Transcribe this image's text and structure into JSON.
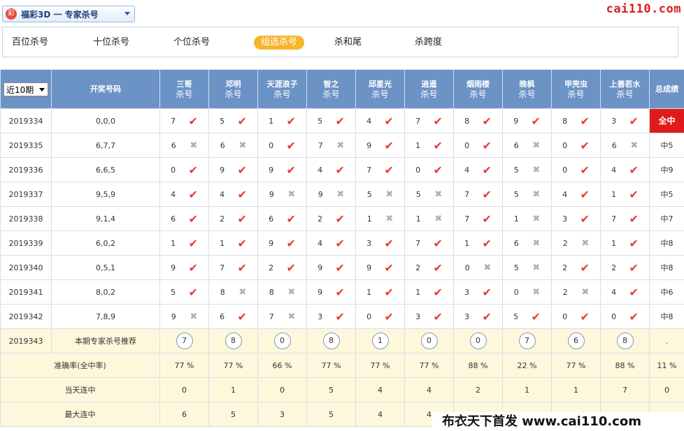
{
  "selector": {
    "icon": "彩",
    "label": "福彩3D 一 专家杀号"
  },
  "brand": "cai110.com",
  "tabs": [
    "百位杀号",
    "十位杀号",
    "个位杀号",
    "组选杀号",
    "杀和尾",
    "杀跨度"
  ],
  "active_tab": 3,
  "period_select": "近10期",
  "header": {
    "draw_col": "开奖号码",
    "total_col": "总成绩",
    "sub": "杀号",
    "experts": [
      "三哥",
      "邓明",
      "天涯浪子",
      "智之",
      "邱星光",
      "逍遥",
      "烟雨楼",
      "晚枫",
      "甲壳虫",
      "上善若水"
    ]
  },
  "rows": [
    {
      "period": "2019334",
      "draw": "0,0,0",
      "picks": [
        [
          "7",
          1
        ],
        [
          "5",
          1
        ],
        [
          "1",
          1
        ],
        [
          "5",
          1
        ],
        [
          "4",
          1
        ],
        [
          "7",
          1
        ],
        [
          "8",
          1
        ],
        [
          "9",
          1
        ],
        [
          "8",
          1
        ],
        [
          "3",
          1
        ]
      ],
      "total": "全中"
    },
    {
      "period": "2019335",
      "draw": "6,7,7",
      "picks": [
        [
          "6",
          0
        ],
        [
          "6",
          0
        ],
        [
          "0",
          1
        ],
        [
          "7",
          0
        ],
        [
          "9",
          1
        ],
        [
          "1",
          1
        ],
        [
          "0",
          1
        ],
        [
          "6",
          0
        ],
        [
          "0",
          1
        ],
        [
          "6",
          0
        ]
      ],
      "total": "中5"
    },
    {
      "period": "2019336",
      "draw": "6,6,5",
      "picks": [
        [
          "0",
          1
        ],
        [
          "9",
          1
        ],
        [
          "9",
          1
        ],
        [
          "4",
          1
        ],
        [
          "7",
          1
        ],
        [
          "0",
          1
        ],
        [
          "4",
          1
        ],
        [
          "5",
          0
        ],
        [
          "0",
          1
        ],
        [
          "4",
          1
        ]
      ],
      "total": "中9"
    },
    {
      "period": "2019337",
      "draw": "9,5,9",
      "picks": [
        [
          "4",
          1
        ],
        [
          "4",
          1
        ],
        [
          "9",
          0
        ],
        [
          "9",
          0
        ],
        [
          "5",
          0
        ],
        [
          "5",
          0
        ],
        [
          "7",
          1
        ],
        [
          "5",
          0
        ],
        [
          "4",
          1
        ],
        [
          "1",
          1
        ]
      ],
      "total": "中5"
    },
    {
      "period": "2019338",
      "draw": "9,1,4",
      "picks": [
        [
          "6",
          1
        ],
        [
          "2",
          1
        ],
        [
          "6",
          1
        ],
        [
          "2",
          1
        ],
        [
          "1",
          0
        ],
        [
          "1",
          0
        ],
        [
          "7",
          1
        ],
        [
          "1",
          0
        ],
        [
          "3",
          1
        ],
        [
          "7",
          1
        ]
      ],
      "total": "中7"
    },
    {
      "period": "2019339",
      "draw": "6,0,2",
      "picks": [
        [
          "1",
          1
        ],
        [
          "1",
          1
        ],
        [
          "9",
          1
        ],
        [
          "4",
          1
        ],
        [
          "3",
          1
        ],
        [
          "7",
          1
        ],
        [
          "1",
          1
        ],
        [
          "6",
          0
        ],
        [
          "2",
          0
        ],
        [
          "1",
          1
        ]
      ],
      "total": "中8"
    },
    {
      "period": "2019340",
      "draw": "0,5,1",
      "picks": [
        [
          "9",
          1
        ],
        [
          "7",
          1
        ],
        [
          "2",
          1
        ],
        [
          "9",
          1
        ],
        [
          "9",
          1
        ],
        [
          "2",
          1
        ],
        [
          "0",
          0
        ],
        [
          "5",
          0
        ],
        [
          "2",
          1
        ],
        [
          "2",
          1
        ]
      ],
      "total": "中8"
    },
    {
      "period": "2019341",
      "draw": "8,0,2",
      "picks": [
        [
          "5",
          1
        ],
        [
          "8",
          0
        ],
        [
          "8",
          0
        ],
        [
          "9",
          1
        ],
        [
          "1",
          1
        ],
        [
          "1",
          1
        ],
        [
          "3",
          1
        ],
        [
          "0",
          0
        ],
        [
          "2",
          0
        ],
        [
          "4",
          1
        ]
      ],
      "total": "中6"
    },
    {
      "period": "2019342",
      "draw": "7,8,9",
      "picks": [
        [
          "9",
          0
        ],
        [
          "6",
          1
        ],
        [
          "7",
          0
        ],
        [
          "3",
          1
        ],
        [
          "0",
          1
        ],
        [
          "3",
          1
        ],
        [
          "3",
          1
        ],
        [
          "5",
          1
        ],
        [
          "0",
          1
        ],
        [
          "0",
          1
        ]
      ],
      "total": "中8"
    }
  ],
  "recommend": {
    "period": "2019343",
    "label": "本期专家杀号推荐",
    "nums": [
      "7",
      "8",
      "0",
      "8",
      "1",
      "0",
      "0",
      "7",
      "6",
      "8"
    ],
    "total": "."
  },
  "stats": [
    {
      "label": "准确率(全中率)",
      "vals": [
        "77 %",
        "77 %",
        "66 %",
        "77 %",
        "77 %",
        "77 %",
        "88 %",
        "22 %",
        "77 %",
        "88 %"
      ],
      "total": "11 %"
    },
    {
      "label": "当天连中",
      "vals": [
        "0",
        "1",
        "0",
        "5",
        "4",
        "4",
        "2",
        "1",
        "1",
        "7"
      ],
      "total": "0"
    },
    {
      "label": "最大连中",
      "vals": [
        "6",
        "5",
        "3",
        "5",
        "4",
        "4",
        "",
        "",
        "",
        "",
        ""
      ],
      "total": ""
    }
  ],
  "watermark": "布衣天下首发 www.cai110.com",
  "symbols": {
    "check": "✔",
    "cross": "✖"
  }
}
